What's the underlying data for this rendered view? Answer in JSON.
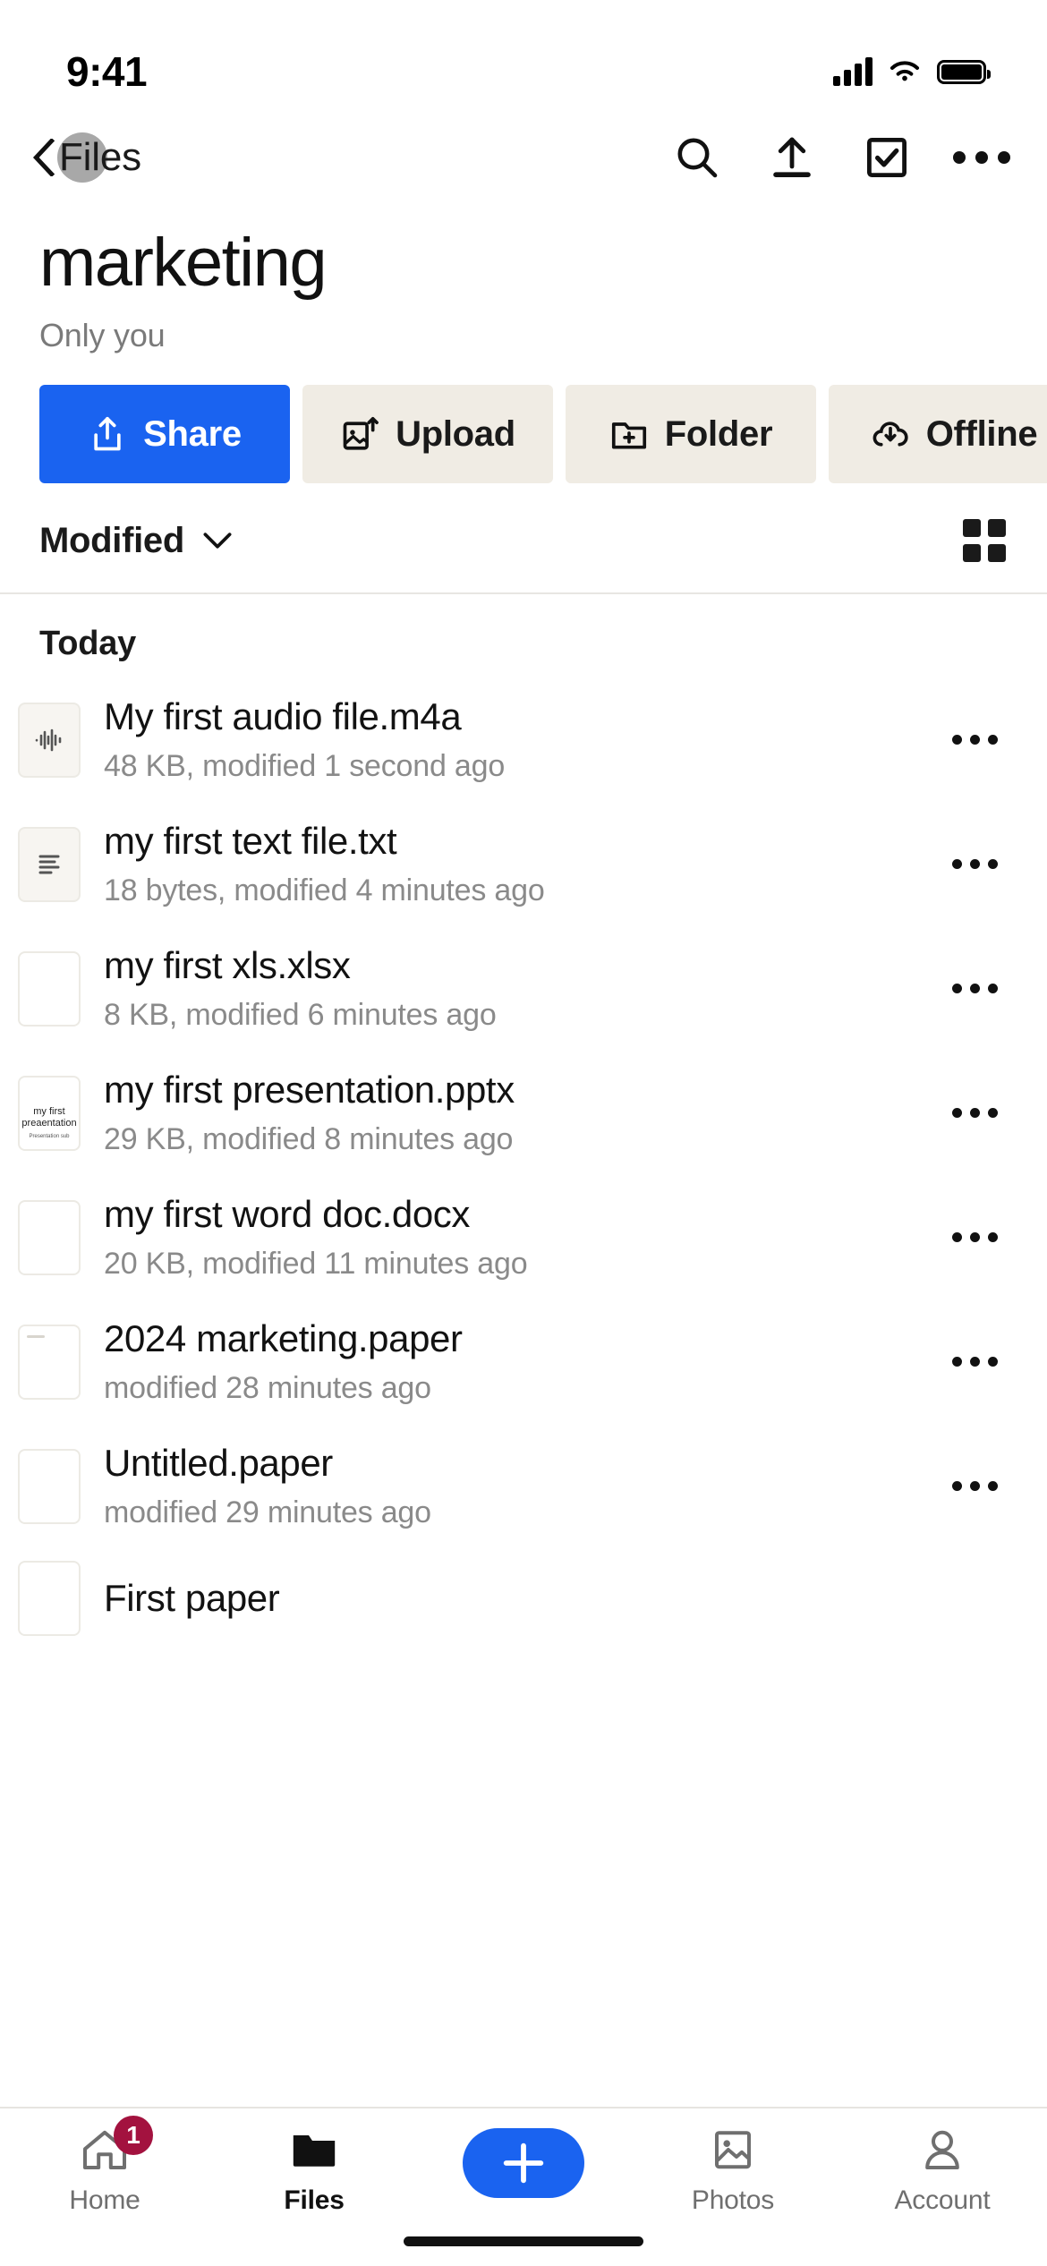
{
  "status_bar": {
    "time": "9:41",
    "signal_icon": "cellular-bars-icon",
    "wifi_icon": "wifi-icon",
    "battery_icon": "battery-icon"
  },
  "nav_bar": {
    "back_label": "Files",
    "back_icon": "chevron-left-icon",
    "actions": [
      {
        "name": "search",
        "icon": "search-icon"
      },
      {
        "name": "upload",
        "icon": "upload-icon"
      },
      {
        "name": "select",
        "icon": "checkbox-checked-icon"
      },
      {
        "name": "more",
        "icon": "more-horizontal-icon"
      }
    ]
  },
  "header": {
    "title": "marketing",
    "subtitle": "Only you"
  },
  "action_chips": [
    {
      "label": "Share",
      "icon": "share-icon",
      "primary": true
    },
    {
      "label": "Upload",
      "icon": "image-upload-icon",
      "primary": false
    },
    {
      "label": "Folder",
      "icon": "folder-plus-icon",
      "primary": false
    },
    {
      "label": "Offline",
      "icon": "cloud-download-icon",
      "primary": false
    }
  ],
  "sort_bar": {
    "sort_label": "Modified",
    "sort_chevron": "chevron-down-icon",
    "view_toggle_icon": "grid-view-icon"
  },
  "list": {
    "section_header": "Today",
    "items": [
      {
        "name": "My first audio file.m4a",
        "meta": "48 KB, modified 1 second ago",
        "thumb": "audio-waveform-icon",
        "more_icon": "more-horizontal-icon"
      },
      {
        "name": "my first text file.txt",
        "meta": "18 bytes, modified 4 minutes ago",
        "thumb": "text-lines-icon",
        "more_icon": "more-horizontal-icon"
      },
      {
        "name": "my first xls.xlsx",
        "meta": "8 KB, modified 6 minutes ago",
        "thumb": "blank-document-icon",
        "more_icon": "more-horizontal-icon"
      },
      {
        "name": "my first presentation.pptx",
        "meta": "29 KB, modified 8 minutes ago",
        "thumb": "presentation-preview",
        "more_icon": "more-horizontal-icon",
        "preview": {
          "title": "my first preaentation",
          "subtitle": "Presentation sub"
        }
      },
      {
        "name": "my first word doc.docx",
        "meta": "20 KB, modified 11 minutes ago",
        "thumb": "blank-document-icon",
        "more_icon": "more-horizontal-icon"
      },
      {
        "name": "2024 marketing.paper",
        "meta": "modified 28 minutes ago",
        "thumb": "paper-document-icon",
        "more_icon": "more-horizontal-icon"
      },
      {
        "name": "Untitled.paper",
        "meta": "modified 29 minutes ago",
        "thumb": "blank-document-icon",
        "more_icon": "more-horizontal-icon"
      },
      {
        "name": "First paper",
        "meta": "",
        "thumb": "blank-document-icon",
        "more_icon": "more-horizontal-icon"
      }
    ]
  },
  "tab_bar": {
    "tabs": [
      {
        "label": "Home",
        "icon": "home-icon",
        "badge": "1",
        "active": false
      },
      {
        "label": "Files",
        "icon": "folder-icon",
        "badge": "",
        "active": true
      },
      {
        "label": "Photos",
        "icon": "photo-icon",
        "badge": "",
        "active": false
      },
      {
        "label": "Account",
        "icon": "person-icon",
        "badge": "",
        "active": false
      }
    ],
    "fab_icon": "plus-icon"
  },
  "colors": {
    "accent_blue": "#1a63f0",
    "chip_bg": "#f0ece4",
    "badge_red": "#a3123f",
    "meta_gray": "#8a8a8a"
  }
}
